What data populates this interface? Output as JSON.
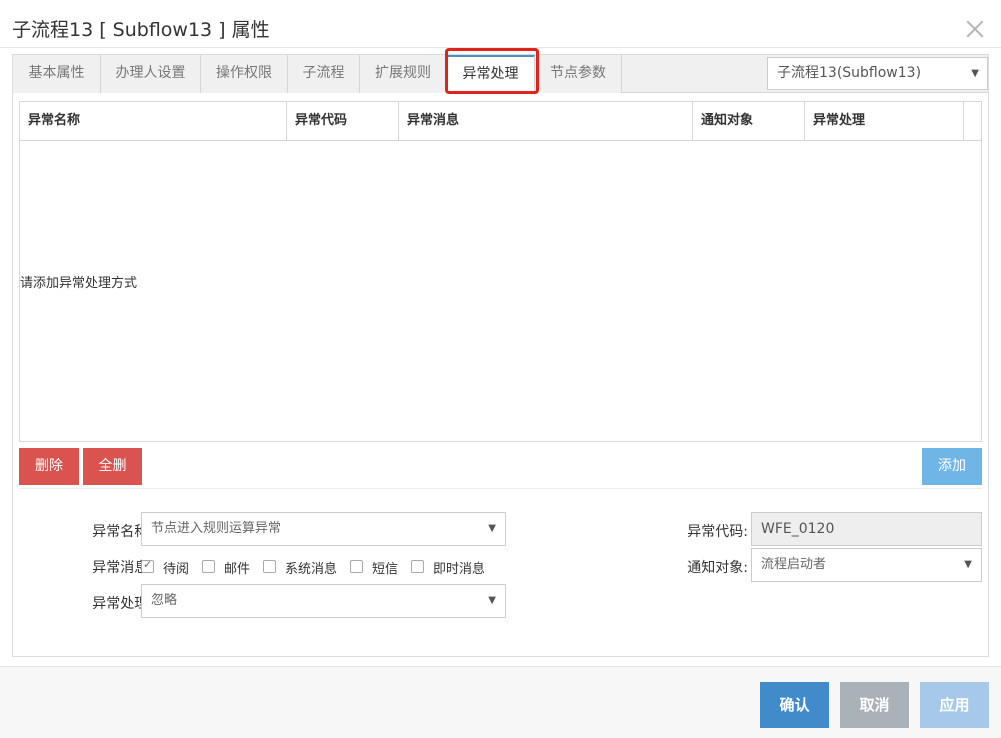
{
  "dialog": {
    "title": "子流程13 [ Subflow13 ] 属性"
  },
  "tabs": [
    {
      "label": "基本属性"
    },
    {
      "label": "办理人设置"
    },
    {
      "label": "操作权限"
    },
    {
      "label": "子流程"
    },
    {
      "label": "扩展规则"
    },
    {
      "label": "异常处理"
    },
    {
      "label": "节点参数"
    }
  ],
  "active_tab": "异常处理",
  "node_select": {
    "value": "子流程13(Subflow13)"
  },
  "grid": {
    "columns": [
      "异常名称",
      "异常代码",
      "异常消息",
      "通知对象",
      "异常处理"
    ],
    "empty_message": "请添加异常处理方式"
  },
  "buttons": {
    "delete": "删除",
    "delete_all": "全删",
    "add": "添加"
  },
  "form": {
    "exception_name": {
      "label": "异常名称:",
      "value": "节点进入规则运算异常"
    },
    "exception_code": {
      "label": "异常代码:",
      "value": "WFE_0120"
    },
    "exception_message": {
      "label": "异常消息:",
      "options": [
        {
          "label": "待阅",
          "checked": true
        },
        {
          "label": "邮件",
          "checked": false
        },
        {
          "label": "系统消息",
          "checked": false
        },
        {
          "label": "短信",
          "checked": false
        },
        {
          "label": "即时消息",
          "checked": false
        }
      ]
    },
    "notify_target": {
      "label": "通知对象:",
      "value": "流程启动者"
    },
    "exception_handling": {
      "label": "异常处理:",
      "value": "忽略"
    }
  },
  "footer": {
    "confirm": "确认",
    "cancel": "取消",
    "apply": "应用"
  },
  "colors": {
    "danger": "#d9534f",
    "primary": "#428bca",
    "disabled_gray": "#a9b2b9",
    "disabled_blue": "#a6c9ea",
    "highlight": "#e0231b"
  }
}
